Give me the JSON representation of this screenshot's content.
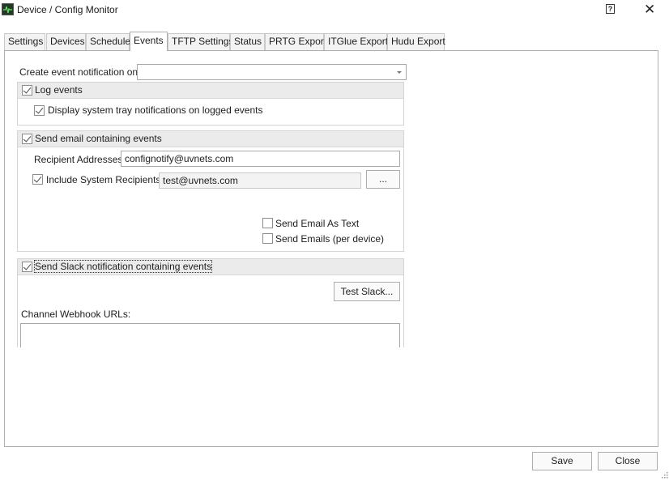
{
  "window": {
    "title": "Device / Config Monitor",
    "help_label": "?",
    "close_glyph": "✕"
  },
  "tabs": [
    {
      "label": "Settings"
    },
    {
      "label": "Devices"
    },
    {
      "label": "Schedule"
    },
    {
      "label": "Events"
    },
    {
      "label": "TFTP Settings"
    },
    {
      "label": "Status"
    },
    {
      "label": "PRTG Export"
    },
    {
      "label": "ITGlue Export"
    },
    {
      "label": "Hudu Export"
    }
  ],
  "active_tab": "Events",
  "events": {
    "create_label": "Create event notification on:",
    "create_value": "",
    "log": {
      "header": "Log events",
      "checked": true,
      "tray_label": "Display system tray notifications on logged events",
      "tray_checked": true
    },
    "email": {
      "header": "Send email containing events",
      "checked": true,
      "recipient_label": "Recipient Addresses:",
      "recipient_value": "confignotify@uvnets.com",
      "system_label": "Include System Recipients:",
      "system_checked": true,
      "system_value": "test@uvnets.com",
      "browse_label": "...",
      "as_text_label": "Send Email As Text",
      "as_text_checked": false,
      "per_device_label": "Send Emails (per device)",
      "per_device_checked": false
    },
    "slack": {
      "header": "Send Slack notification containing events",
      "checked": true,
      "test_label": "Test Slack...",
      "webhook_label": "Channel Webhook URLs:",
      "webhook_value": ""
    }
  },
  "footer": {
    "save_label": "Save",
    "close_label": "Close"
  },
  "colors": {
    "group_header_bg": "#ebebeb",
    "border": "#aeaeae"
  }
}
